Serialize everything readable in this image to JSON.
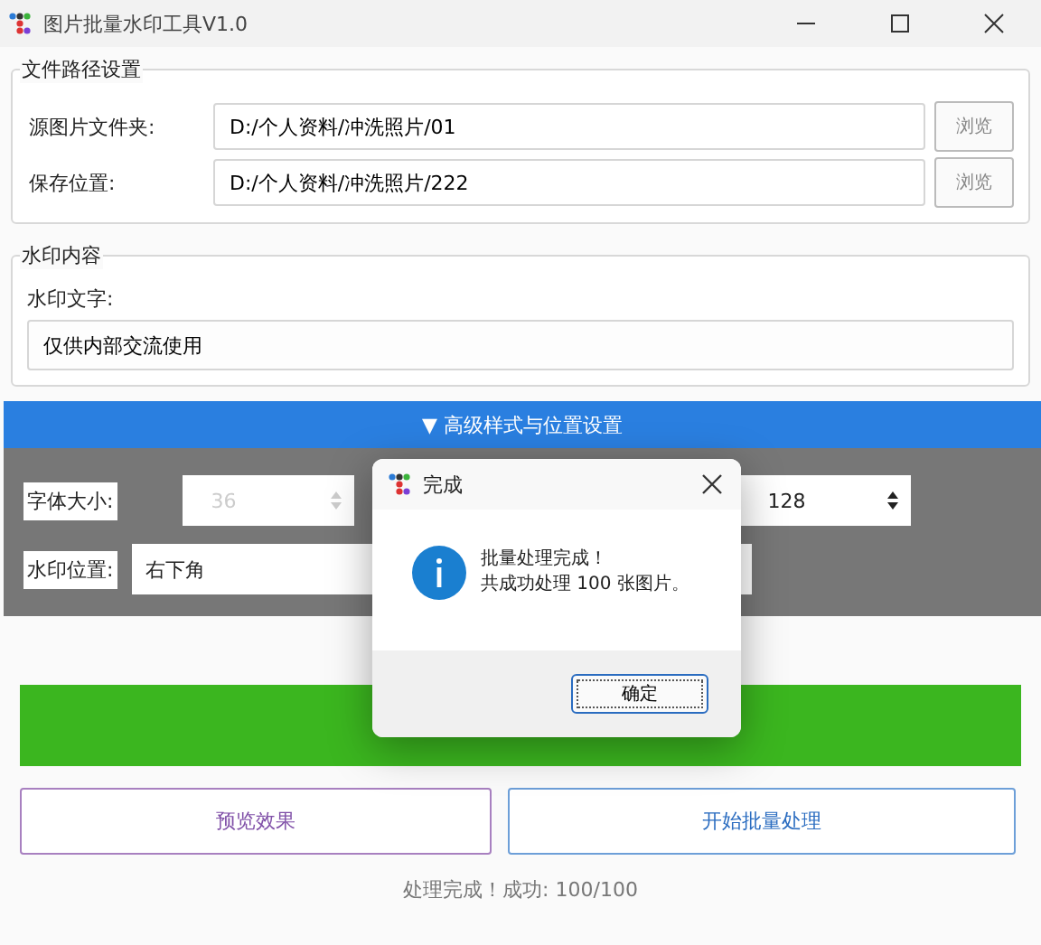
{
  "window": {
    "title": "图片批量水印工具V1.0"
  },
  "paths": {
    "title": "文件路径设置",
    "rows": [
      {
        "label": "源图片文件夹:",
        "value": "D:/个人资料/冲洗照片/01",
        "button": "浏览"
      },
      {
        "label": "保存位置:",
        "value": "D:/个人资料/冲洗照片/222",
        "button": "浏览"
      }
    ]
  },
  "watermark": {
    "title": "水印内容",
    "label": "水印文字:",
    "value": "仅供内部交流使用"
  },
  "advanced": {
    "header": "▼ 高级样式与位置设置",
    "font_size_label": "字体大小:",
    "spinboxes": [
      {
        "value": "36",
        "disabled": true
      },
      {
        "value": "128",
        "disabled": false
      }
    ],
    "position_label": "水印位置:",
    "position_value": "右下角"
  },
  "progress": {
    "level": 1
  },
  "buttons": [
    {
      "label": "预览效果",
      "kind": "preview"
    },
    {
      "label": "开始批量处理",
      "kind": "start"
    }
  ],
  "status": "处理完成！成功: 100/100",
  "dialog": {
    "title": "完成",
    "lines": [
      "批量处理完成！",
      "共成功处理 100 张图片。"
    ],
    "button": "确定"
  }
}
